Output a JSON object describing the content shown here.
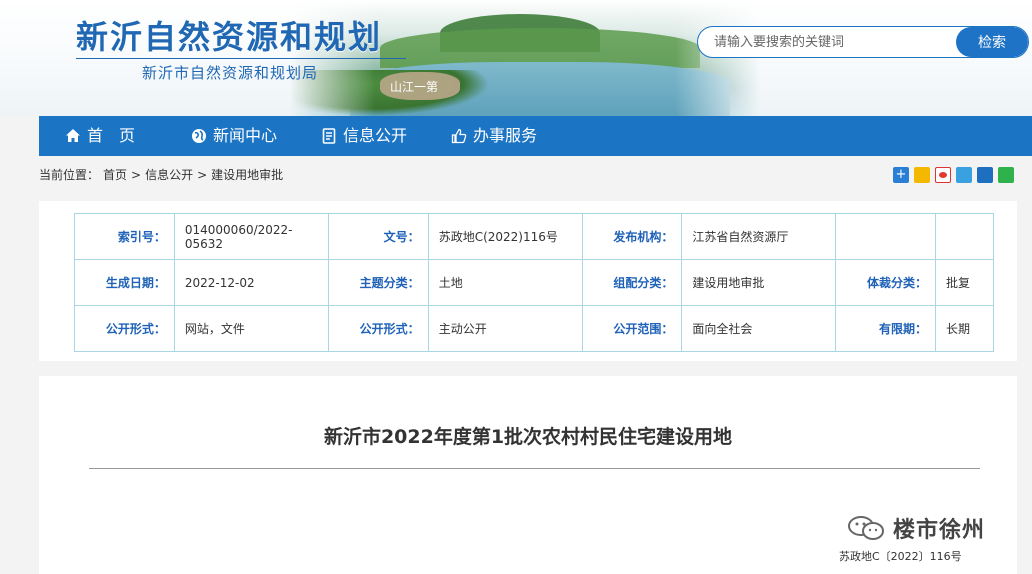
{
  "header": {
    "title": "新沂自然资源和规划",
    "subtitle": "新沂市自然资源和规划局",
    "scene_caption": "山江一第",
    "search": {
      "placeholder": "请输入要搜索的关键词",
      "button": "检索"
    }
  },
  "nav": {
    "items": [
      {
        "label": "首　页",
        "icon": "home-icon"
      },
      {
        "label": "新闻中心",
        "icon": "globe-icon"
      },
      {
        "label": "信息公开",
        "icon": "document-icon"
      },
      {
        "label": "办事服务",
        "icon": "thumbs-up-icon"
      }
    ],
    "color": "#1c74c5"
  },
  "breadcrumb": {
    "prefix": "当前位置：",
    "items": [
      "首页",
      "信息公开",
      "建设用地审批"
    ],
    "sep1": ">",
    "sep2": ">"
  },
  "share_icons": [
    "share-plus-icon",
    "qzone-icon",
    "weibo-icon",
    "tencent-icon",
    "renren-icon",
    "wechat-icon"
  ],
  "meta": {
    "rows": [
      [
        {
          "k": "索引号：",
          "v": "014000060/2022-05632"
        },
        {
          "k": "文号：",
          "v": "苏政地C(2022)116号"
        },
        {
          "k": "发布机构：",
          "v": "江苏省自然资源厅"
        },
        {
          "k": "",
          "v": ""
        }
      ],
      [
        {
          "k": "生成日期：",
          "v": "2022-12-02"
        },
        {
          "k": "主题分类：",
          "v": "土地"
        },
        {
          "k": "组配分类：",
          "v": "建设用地审批"
        },
        {
          "k": "体裁分类：",
          "v": "批复"
        }
      ],
      [
        {
          "k": "公开形式：",
          "v": "网站，文件"
        },
        {
          "k": "公开形式：",
          "v": "主动公开"
        },
        {
          "k": "公开范围：",
          "v": "面向全社会"
        },
        {
          "k": "有限期：",
          "v": "长期"
        }
      ]
    ]
  },
  "article": {
    "title": "新沂市2022年度第1批次农村村民住宅建设用地",
    "watermark": "楼市徐州",
    "doc_number": "苏政地C〔2022〕116号"
  }
}
